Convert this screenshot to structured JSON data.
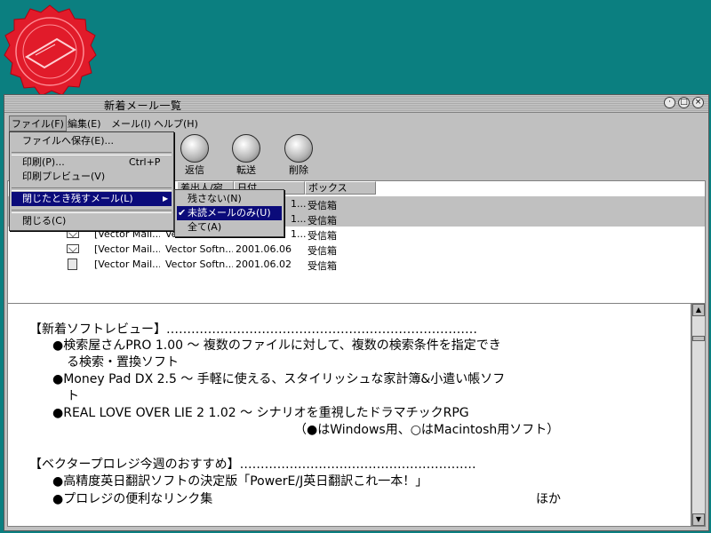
{
  "window": {
    "title": "新着メール一覧"
  },
  "menubar": [
    {
      "label": "ファイル(F)"
    },
    {
      "label": "編集(E)"
    },
    {
      "label": "メール(I)"
    },
    {
      "label": "ヘルプ(H)"
    }
  ],
  "file_menu": {
    "save_to_file": "ファイルへ保存(E)...",
    "print": "印刷(P)...",
    "print_shortcut": "Ctrl+P",
    "print_preview": "印刷プレビュー(V)",
    "keep_on_close": "閉じたとき残すメール(L)",
    "close": "閉じる(C)"
  },
  "submenu": {
    "none": "残さない(N)",
    "unread_only": "未読メールのみ(U)",
    "all": "全て(A)"
  },
  "toolbar": {
    "reply": "返信",
    "forward": "転送",
    "delete": "削除"
  },
  "columns": {
    "from": "差出人/宛",
    "date": "日付",
    "box": "ボックス"
  },
  "rows": [
    {
      "subject": "",
      "from": "",
      "date": "1...",
      "box": "受信箱"
    },
    {
      "subject": "",
      "from": "",
      "date": "1...",
      "box": "受信箱"
    },
    {
      "subject": "[Vector Mail...",
      "from": "Vector Softn...",
      "date": "1...",
      "box": "受信箱"
    },
    {
      "subject": "[Vector Mail...",
      "from": "Vector Softn...",
      "date": "2001.06.06",
      "box": "受信箱"
    },
    {
      "subject": "[Vector Mail...",
      "from": "Vector Softn...",
      "date": "2001.06.02",
      "box": "受信箱"
    }
  ],
  "preview": {
    "lines": [
      "【新着ソフトレビュー】…………………………………………………………………",
      "●検索屋さんPRO 1.00 ～ 複数のファイルに対して、複数の検索条件を指定でき",
      "る検索・置換ソフト",
      "●Money Pad DX 2.5 ～ 手軽に使える、スタイリッシュな家計簿&小遣い帳ソフ",
      "ト",
      "●REAL LOVE OVER LIE 2 1.02 ～ シナリオを重視したドラマチックRPG",
      "（●はWindows用、○はMacintosh用ソフト）",
      "【ベクタープロレジ今週のおすすめ】…………………………………………………",
      "●高精度英日翻訳ソフトの決定版「PowerE/J英日翻訳これ一本！」",
      "●プロレジの便利なリンク集",
      "ほか"
    ]
  }
}
